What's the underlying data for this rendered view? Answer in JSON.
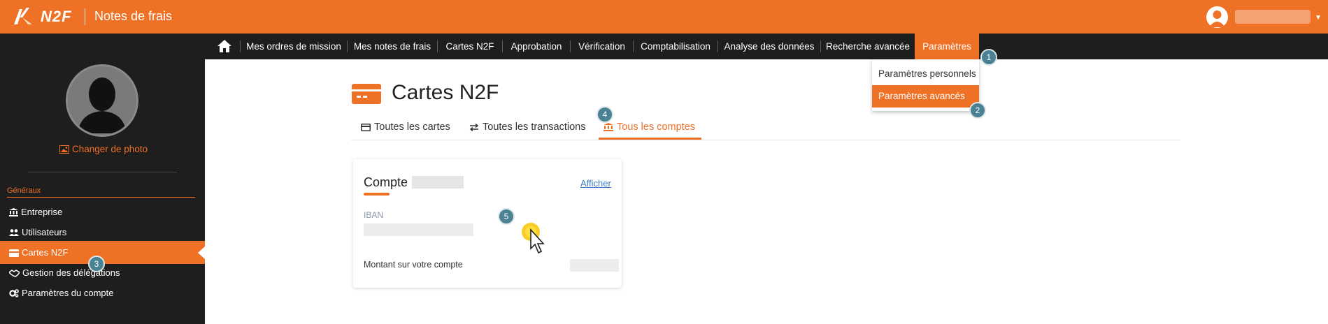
{
  "header": {
    "brand": "N2F",
    "app_title": "Notes de frais"
  },
  "nav": {
    "items": [
      "Mes ordres de mission",
      "Mes notes de frais",
      "Cartes N2F",
      "Approbation",
      "Vérification",
      "Comptabilisation",
      "Analyse des données",
      "Recherche avancée",
      "Paramètres"
    ],
    "active": "Paramètres"
  },
  "dropdown": {
    "items": [
      "Paramètres personnels",
      "Paramètres avancés"
    ],
    "active": "Paramètres avancés"
  },
  "sidebar": {
    "change_photo": "Changer de photo",
    "section": "Généraux",
    "items": [
      "Entreprise",
      "Utilisateurs",
      "Cartes N2F",
      "Gestion des délégations",
      "Paramètres du compte"
    ],
    "active": "Cartes N2F"
  },
  "page": {
    "title": "Cartes N2F",
    "tabs": [
      "Toutes les cartes",
      "Toutes les transactions",
      "Tous les comptes"
    ],
    "active_tab": "Tous les comptes"
  },
  "card": {
    "title": "Compte",
    "link": "Afficher",
    "iban_label": "IBAN",
    "amount_label": "Montant sur votre compte"
  },
  "badges": [
    "1",
    "2",
    "3",
    "4",
    "5"
  ],
  "colors": {
    "accent": "#ee7126",
    "dark": "#1e1e1e",
    "badge": "#4a8293",
    "link": "#3d7ac6"
  }
}
